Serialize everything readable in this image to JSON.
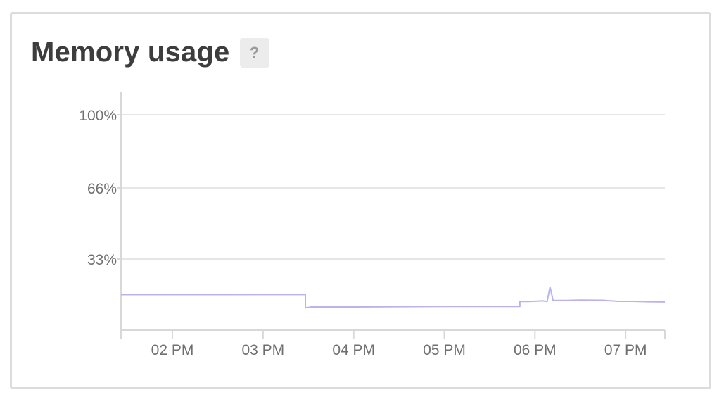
{
  "card": {
    "title": "Memory usage",
    "help_label": "?"
  },
  "colors": {
    "series": "#b9b4ec",
    "grid": "#e6e6e6",
    "axis": "#d8d8d8",
    "text": "#6f6f6f",
    "title": "#3d3d3d"
  },
  "chart_data": {
    "type": "line",
    "title": "Memory usage",
    "xlabel": "",
    "ylabel": "",
    "ylim": [
      0,
      100
    ],
    "xlim": [
      "13:26",
      "19:26"
    ],
    "y_ticks": [
      {
        "value": 100,
        "label": "100%"
      },
      {
        "value": 66,
        "label": "66%"
      },
      {
        "value": 33,
        "label": "33%"
      }
    ],
    "x_ticks": [
      {
        "value": "14:00",
        "label": "02 PM"
      },
      {
        "value": "15:00",
        "label": "03 PM"
      },
      {
        "value": "16:00",
        "label": "04 PM"
      },
      {
        "value": "17:00",
        "label": "05 PM"
      },
      {
        "value": "18:00",
        "label": "06 PM"
      },
      {
        "value": "19:00",
        "label": "07 PM"
      }
    ],
    "grid": true,
    "series": [
      {
        "points": [
          {
            "x": "13:26",
            "y": 16.5
          },
          {
            "x": "14:30",
            "y": 16.5
          },
          {
            "x": "15:28",
            "y": 16.6
          },
          {
            "x": "15:28",
            "y": 10.4
          },
          {
            "x": "15:32",
            "y": 10.8
          },
          {
            "x": "16:00",
            "y": 10.8
          },
          {
            "x": "16:30",
            "y": 10.9
          },
          {
            "x": "17:00",
            "y": 11.0
          },
          {
            "x": "17:30",
            "y": 11.0
          },
          {
            "x": "17:50",
            "y": 11.0
          },
          {
            "x": "17:50",
            "y": 13.3
          },
          {
            "x": "17:55",
            "y": 13.3
          },
          {
            "x": "18:05",
            "y": 13.6
          },
          {
            "x": "18:08",
            "y": 13.3
          },
          {
            "x": "18:10",
            "y": 20.0
          },
          {
            "x": "18:12",
            "y": 13.8
          },
          {
            "x": "18:20",
            "y": 13.8
          },
          {
            "x": "18:30",
            "y": 14.0
          },
          {
            "x": "18:45",
            "y": 13.9
          },
          {
            "x": "18:55",
            "y": 13.4
          },
          {
            "x": "19:05",
            "y": 13.4
          },
          {
            "x": "19:15",
            "y": 13.2
          },
          {
            "x": "19:26",
            "y": 13.1
          }
        ]
      }
    ]
  }
}
